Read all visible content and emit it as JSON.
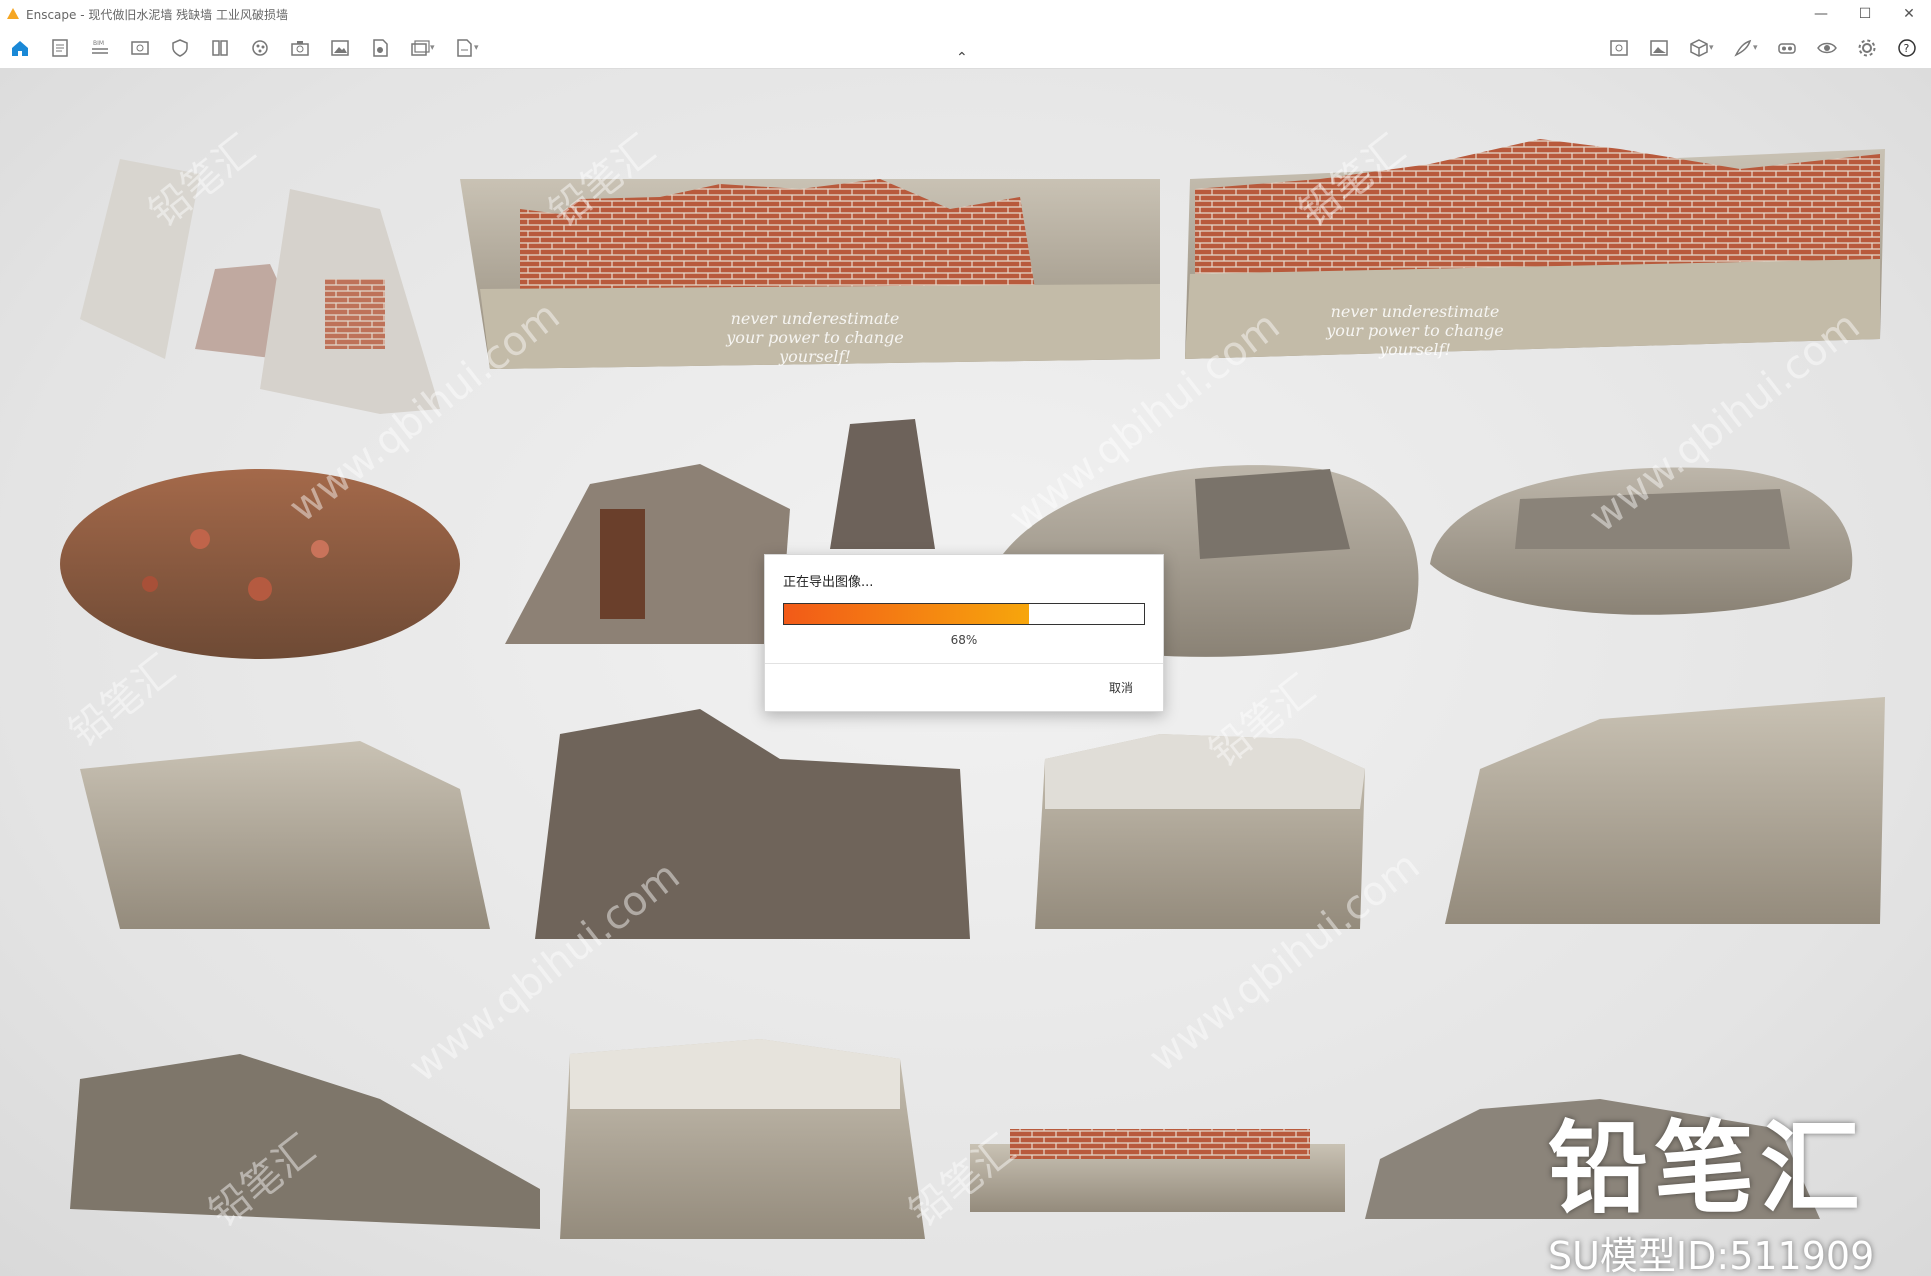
{
  "window": {
    "title": "Enscape - 现代做旧水泥墙 残缺墙 工业风破损墙",
    "controls": [
      "minimize",
      "maximize",
      "close"
    ]
  },
  "toolbar": {
    "left_tools": [
      {
        "name": "home-icon",
        "has_dropdown": false
      },
      {
        "name": "document-icon",
        "has_dropdown": false
      },
      {
        "name": "bim-icon",
        "label": "BIM",
        "has_dropdown": false
      },
      {
        "name": "view-icon",
        "has_dropdown": false
      },
      {
        "name": "shield-icon",
        "has_dropdown": false
      },
      {
        "name": "library-icon",
        "has_dropdown": false
      },
      {
        "name": "material-icon",
        "has_dropdown": false
      },
      {
        "name": "camera-icon",
        "has_dropdown": false
      },
      {
        "name": "screenshot-icon",
        "has_dropdown": false
      },
      {
        "name": "render-icon",
        "has_dropdown": false
      },
      {
        "name": "batch-render-icon",
        "has_dropdown": true
      },
      {
        "name": "export-icon",
        "has_dropdown": true
      }
    ],
    "right_tools": [
      {
        "name": "map-icon",
        "has_dropdown": false
      },
      {
        "name": "image-icon",
        "has_dropdown": false
      },
      {
        "name": "cube-icon",
        "has_dropdown": true
      },
      {
        "name": "feather-icon",
        "has_dropdown": true
      },
      {
        "name": "vr-headset-icon",
        "has_dropdown": false
      },
      {
        "name": "eye-icon",
        "has_dropdown": false
      },
      {
        "name": "settings-icon",
        "has_dropdown": false
      },
      {
        "name": "help-icon",
        "has_dropdown": false
      }
    ]
  },
  "wall_text": {
    "line1": "never underestimate",
    "line2": "your power to change yourself!"
  },
  "dialog": {
    "title": "正在导出图像...",
    "progress": 0.68,
    "percent_label": "68%",
    "cancel_label": "取消"
  },
  "watermarks": [
    "铅笔汇",
    "www.qbihui.com"
  ],
  "branding": {
    "main": "铅笔汇",
    "sub": "SU模型ID:511909"
  },
  "colors": {
    "progress_start": "#f25a18",
    "progress_end": "#f7a60c",
    "accent_home": "#1a88d6"
  }
}
